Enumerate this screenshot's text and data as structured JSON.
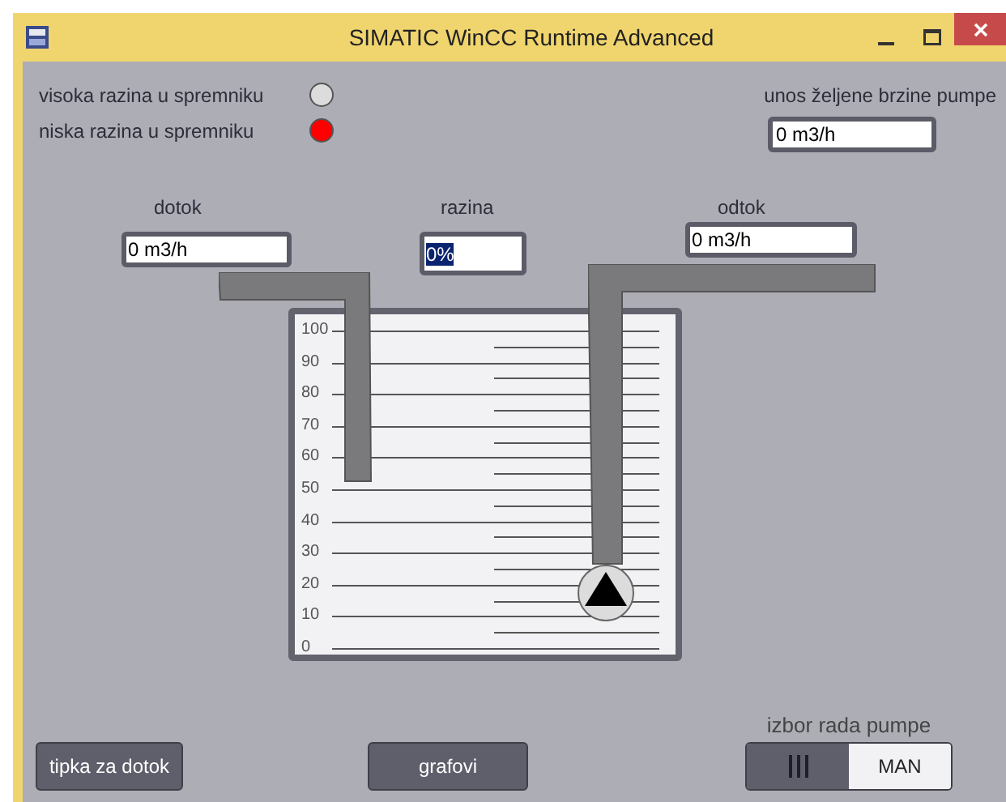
{
  "window": {
    "title": "SIMATIC WinCC Runtime Advanced"
  },
  "indicators": [
    {
      "label": "visoka razina u spremniku",
      "color": "#dcdcdc"
    },
    {
      "label": "niska razina u spremniku",
      "color": "#ff0000"
    }
  ],
  "pump_speed": {
    "label": "unos željene brzine pumpe",
    "value": "0 m3/h"
  },
  "fields": [
    {
      "label": "dotok",
      "value": "0 m3/h",
      "selected": false
    },
    {
      "label": "razina",
      "value": "0%",
      "selected": true
    },
    {
      "label": "odtok",
      "value": "0 m3/h",
      "selected": false
    }
  ],
  "tank": {
    "scale": [
      "100",
      "90",
      "80",
      "70",
      "60",
      "50",
      "40",
      "30",
      "20",
      "10",
      "0"
    ]
  },
  "buttons": [
    {
      "label": "tipka za dotok"
    },
    {
      "label": "grafovi"
    }
  ],
  "pump_mode": {
    "label": "izbor rada pumpe",
    "options": [
      {
        "kind": "icon",
        "selected": false
      },
      {
        "kind": "text",
        "label": "MAN",
        "selected": true
      }
    ]
  }
}
